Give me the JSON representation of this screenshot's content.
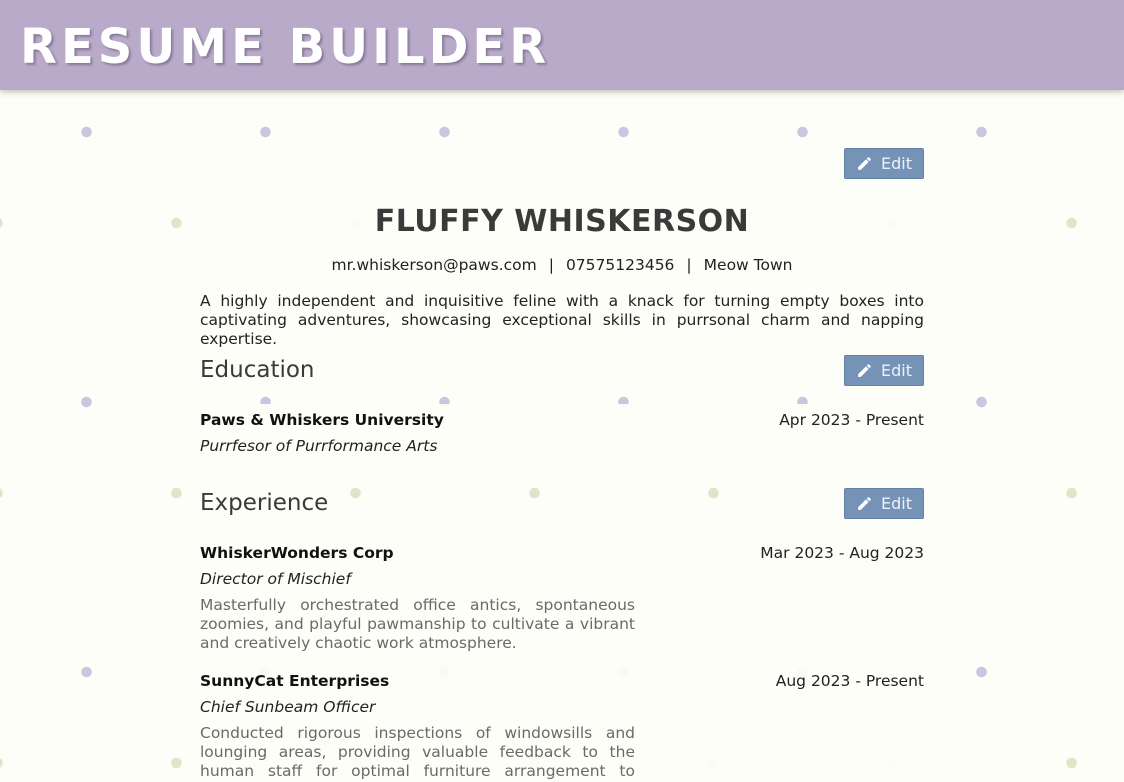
{
  "header": {
    "title": "RESUME BUILDER"
  },
  "profile": {
    "edit_label": "Edit",
    "name": "FLUFFY WHISKERSON",
    "email": "mr.whiskerson@paws.com",
    "separator": "|",
    "phone": "07575123456",
    "location": "Meow Town",
    "summary": "A highly independent and inquisitive feline with a knack for turning empty boxes into captivating adventures, showcasing exceptional skills in purrsonal charm and napping expertise."
  },
  "education": {
    "title": "Education",
    "edit_label": "Edit",
    "items": [
      {
        "institution": "Paws & Whiskers University",
        "date": "Apr 2023 - Present",
        "degree": "Purrfesor of Purrformance Arts"
      }
    ]
  },
  "experience": {
    "title": "Experience",
    "edit_label": "Edit",
    "items": [
      {
        "company": "WhiskerWonders Corp",
        "date": "Mar 2023 - Aug 2023",
        "role": "Director of Mischief",
        "description": "Masterfully orchestrated office antics, spontaneous zoomies, and playful pawmanship to cultivate a vibrant and creatively chaotic work atmosphere."
      },
      {
        "company": "SunnyCat Enterprises",
        "date": "Aug 2023 - Present",
        "role": "Chief Sunbeam Officer",
        "description": "Conducted rigorous inspections of windowsills and lounging areas, providing valuable feedback to the human staff for optimal furniture arrangement to maximize sun exposure."
      }
    ]
  },
  "colors": {
    "header_bg": "#b8aac8",
    "button_bg": "#7593b7"
  },
  "icons": {
    "edit": "pencil-icon"
  }
}
